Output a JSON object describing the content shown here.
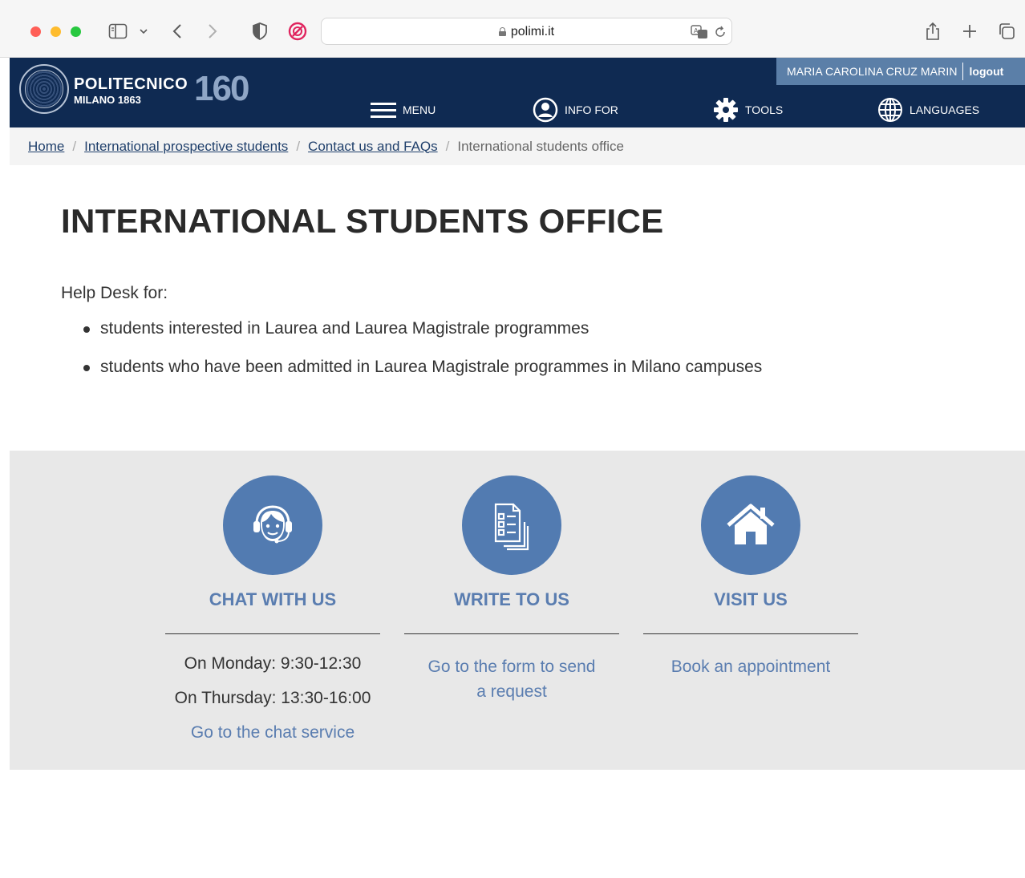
{
  "browser": {
    "url": "polimi.it"
  },
  "header": {
    "brand_name": "POLITECNICO",
    "brand_sub": "MILANO 1863",
    "brand_anniversary": "160",
    "user_name": "MARIA CAROLINA CRUZ MARIN",
    "logout": "logout",
    "nav": [
      {
        "label": "MENU",
        "icon": "hamburger-icon"
      },
      {
        "label": "INFO FOR",
        "icon": "user-circle-icon"
      },
      {
        "label": "TOOLS",
        "icon": "gear-icon"
      },
      {
        "label": "LANGUAGES",
        "icon": "globe-icon"
      }
    ]
  },
  "breadcrumb": {
    "items": [
      "Home",
      "International prospective students",
      "Contact us and FAQs"
    ],
    "current": "International students office"
  },
  "main": {
    "title": "INTERNATIONAL STUDENTS OFFICE",
    "intro": "Help Desk for:",
    "bullets": [
      "students interested in Laurea and Laurea Magistrale programmes",
      "students who have been admitted in Laurea Magistrale programmes in Milano campuses"
    ]
  },
  "contact": {
    "chat": {
      "title": "CHAT WITH US",
      "hours_1": "On Monday: 9:30-12:30",
      "hours_2": "On Thursday: 13:30-16:00",
      "link": "Go to the chat service",
      "icon": "headset-icon"
    },
    "write": {
      "title": "WRITE TO US",
      "link_1": "Go to the form to send",
      "link_2": "a request",
      "icon": "form-document-icon"
    },
    "visit": {
      "title": "VISIT US",
      "link": "Book an appointment",
      "icon": "house-icon"
    }
  },
  "colors": {
    "header_bg": "#0f2a52",
    "user_bar_bg": "#5b7fa8",
    "accent_blue": "#527bb1",
    "link_blue": "#5a7db0",
    "band_bg": "#e8e8e8"
  }
}
